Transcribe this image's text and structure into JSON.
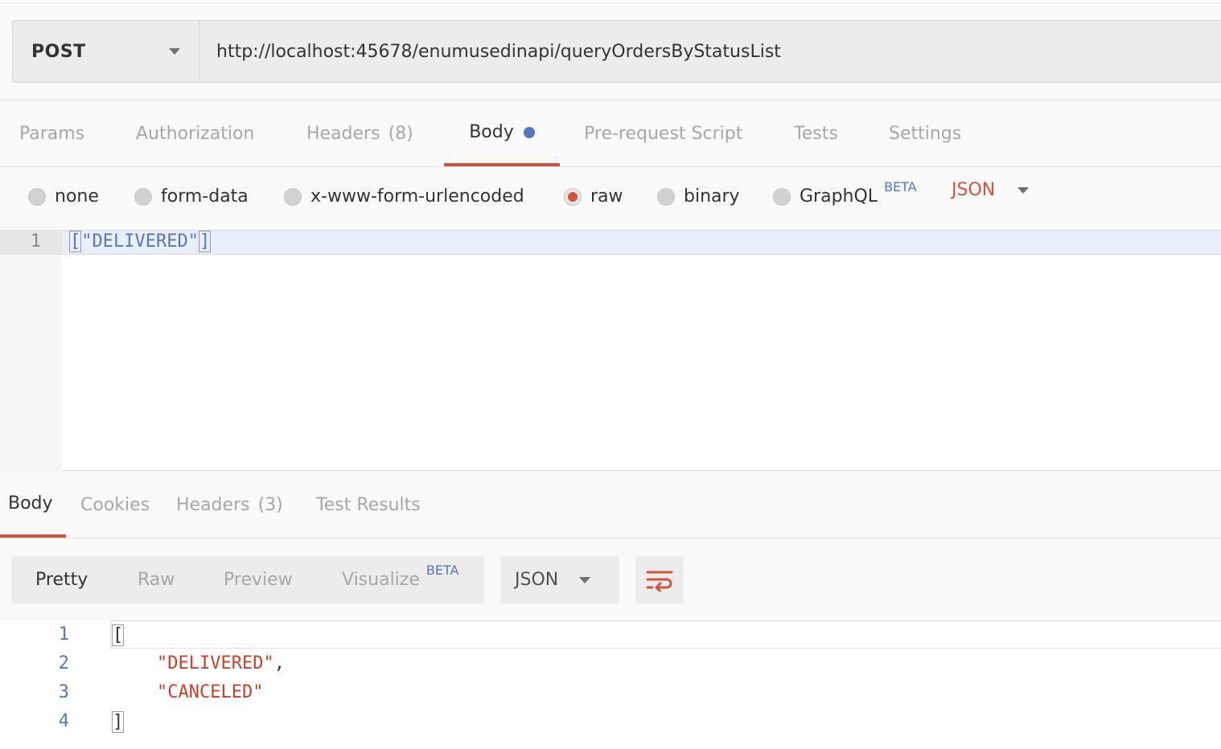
{
  "request": {
    "method": "POST",
    "url": "http://localhost:45678/enumusedinapi/queryOrdersByStatusList"
  },
  "request_tabs": [
    {
      "label": "Params"
    },
    {
      "label": "Authorization"
    },
    {
      "label": "Headers",
      "count": "(8)"
    },
    {
      "label": "Body",
      "active": true,
      "modified_dot": true
    },
    {
      "label": "Pre-request Script"
    },
    {
      "label": "Tests"
    },
    {
      "label": "Settings"
    }
  ],
  "body_types": [
    {
      "label": "none"
    },
    {
      "label": "form-data"
    },
    {
      "label": "x-www-form-urlencoded"
    },
    {
      "label": "raw",
      "checked": true
    },
    {
      "label": "binary"
    },
    {
      "label": "GraphQL",
      "badge": "BETA"
    }
  ],
  "raw_format": "JSON",
  "request_body": {
    "line_number": "1",
    "open": "[",
    "content": "\"DELIVERED\"",
    "close": "]"
  },
  "response_tabs": [
    {
      "label": "Body",
      "active": true
    },
    {
      "label": "Cookies"
    },
    {
      "label": "Headers",
      "count": "(3)"
    },
    {
      "label": "Test Results"
    }
  ],
  "response_views": [
    {
      "label": "Pretty",
      "active": true
    },
    {
      "label": "Raw"
    },
    {
      "label": "Preview"
    },
    {
      "label": "Visualize",
      "badge": "BETA"
    }
  ],
  "response_format": "JSON",
  "response_body": {
    "lines": [
      "1",
      "2",
      "3",
      "4"
    ],
    "open": "[",
    "item1": "\"DELIVERED\"",
    "comma": ",",
    "item2": "\"CANCELED\"",
    "close": "]"
  },
  "colors": {
    "accent": "#d0553e",
    "link_blue": "#5a76b8"
  },
  "icons": {
    "dropdown": "chevron-down-icon",
    "wrap": "wrap-lines-icon"
  }
}
